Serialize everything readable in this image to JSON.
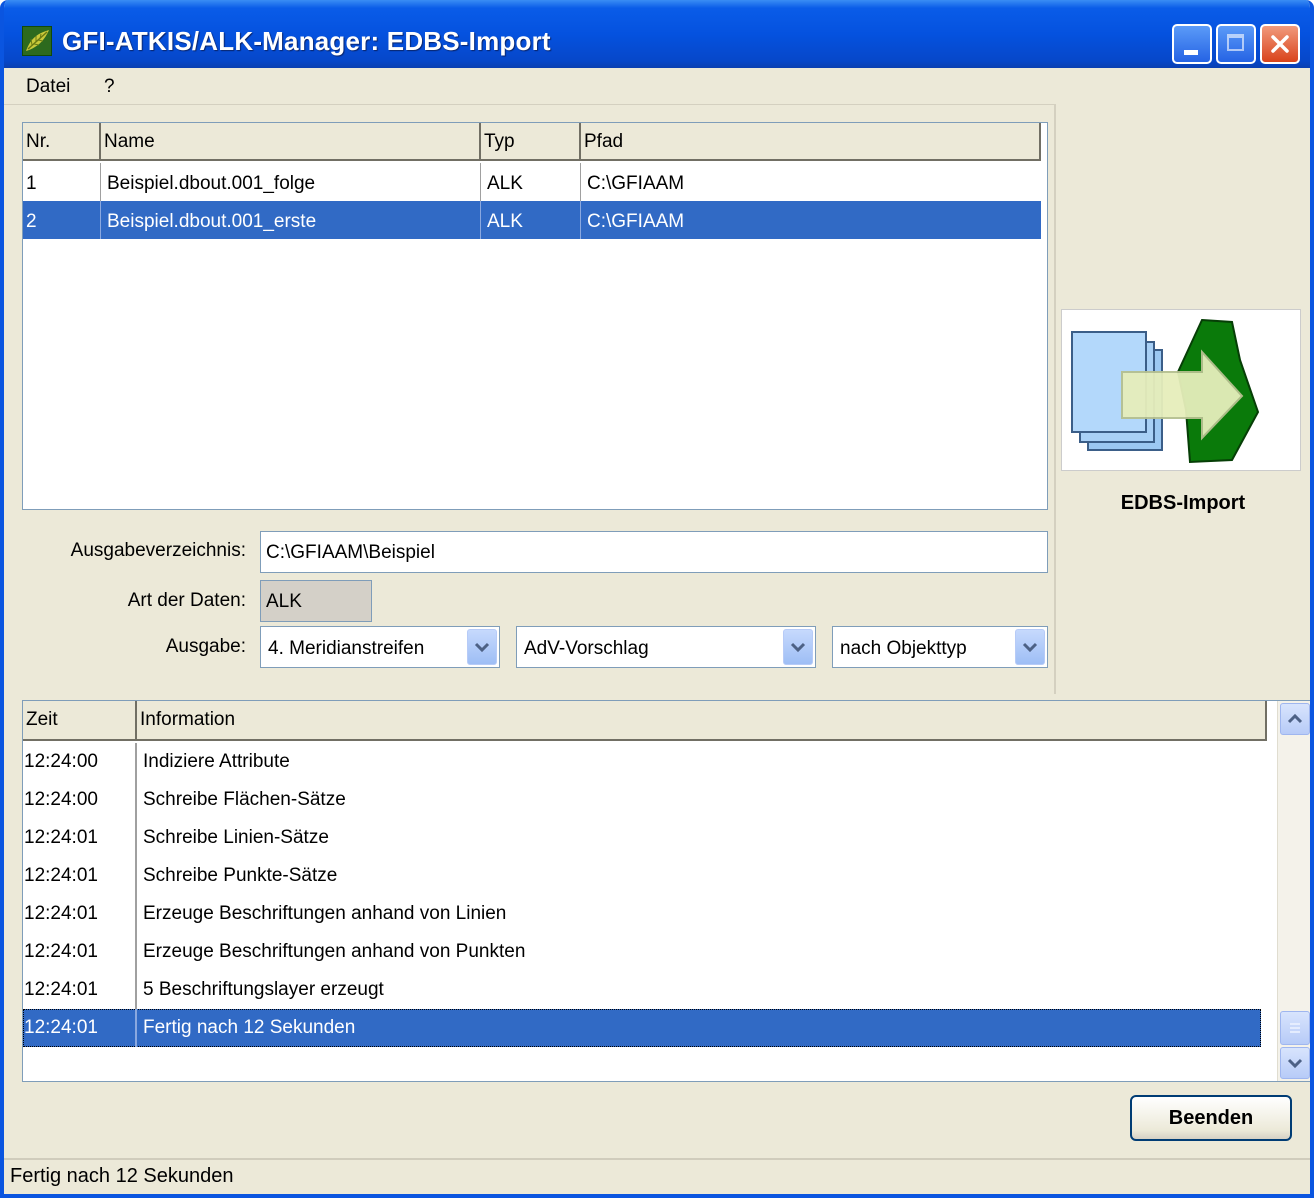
{
  "window": {
    "title": "GFI-ATKIS/ALK-Manager: EDBS-Import",
    "app_icon": "gfi-leaf-icon",
    "controls": [
      "minimize-icon",
      "maximize-icon",
      "close-icon"
    ]
  },
  "menu": {
    "items": [
      {
        "label": "Datei"
      },
      {
        "label": "?"
      }
    ]
  },
  "files_table": {
    "headers": {
      "nr": "Nr.",
      "name": "Name",
      "typ": "Typ",
      "pfad": "Pfad"
    },
    "rows": [
      {
        "nr": "1",
        "name": "Beispiel.dbout.001_folge",
        "typ": "ALK",
        "pfad": "C:\\GFIAAM",
        "selected": false
      },
      {
        "nr": "2",
        "name": "Beispiel.dbout.001_erste",
        "typ": "ALK",
        "pfad": "C:\\GFIAAM",
        "selected": true
      }
    ]
  },
  "form": {
    "ausgabeverzeichnis_label": "Ausgabeverzeichnis:",
    "ausgabeverzeichnis_value": "C:\\GFIAAM\\Beispiel",
    "art_label": "Art der Daten:",
    "art_value": "ALK",
    "ausgabe_label": "Ausgabe:",
    "combo_meridian": "4. Meridianstreifen",
    "combo_vorschlag": "AdV-Vorschlag",
    "combo_objekttyp": "nach Objekttyp"
  },
  "side": {
    "logo_icon": "edbs-import-icon",
    "caption": "EDBS-Import"
  },
  "log": {
    "headers": {
      "zeit": "Zeit",
      "info": "Information"
    },
    "rows": [
      {
        "zeit": "12:24:00",
        "info": "Indiziere Attribute",
        "selected": false
      },
      {
        "zeit": "12:24:00",
        "info": "Schreibe Flächen-Sätze",
        "selected": false
      },
      {
        "zeit": "12:24:01",
        "info": "Schreibe Linien-Sätze",
        "selected": false
      },
      {
        "zeit": "12:24:01",
        "info": "Schreibe Punkte-Sätze",
        "selected": false
      },
      {
        "zeit": "12:24:01",
        "info": "Erzeuge Beschriftungen anhand von Linien",
        "selected": false
      },
      {
        "zeit": "12:24:01",
        "info": "Erzeuge Beschriftungen anhand von Punkten",
        "selected": false
      },
      {
        "zeit": "12:24:01",
        "info": "5 Beschriftungslayer erzeugt",
        "selected": false
      },
      {
        "zeit": "12:24:01",
        "info": "Fertig nach 12 Sekunden",
        "selected": true
      }
    ]
  },
  "buttons": {
    "beenden": "Beenden"
  },
  "status": {
    "text": "Fertig nach 12 Sekunden"
  },
  "colors": {
    "selection": "#316ac5",
    "title_bar": "#0552df",
    "window_bg": "#ece9d8"
  }
}
